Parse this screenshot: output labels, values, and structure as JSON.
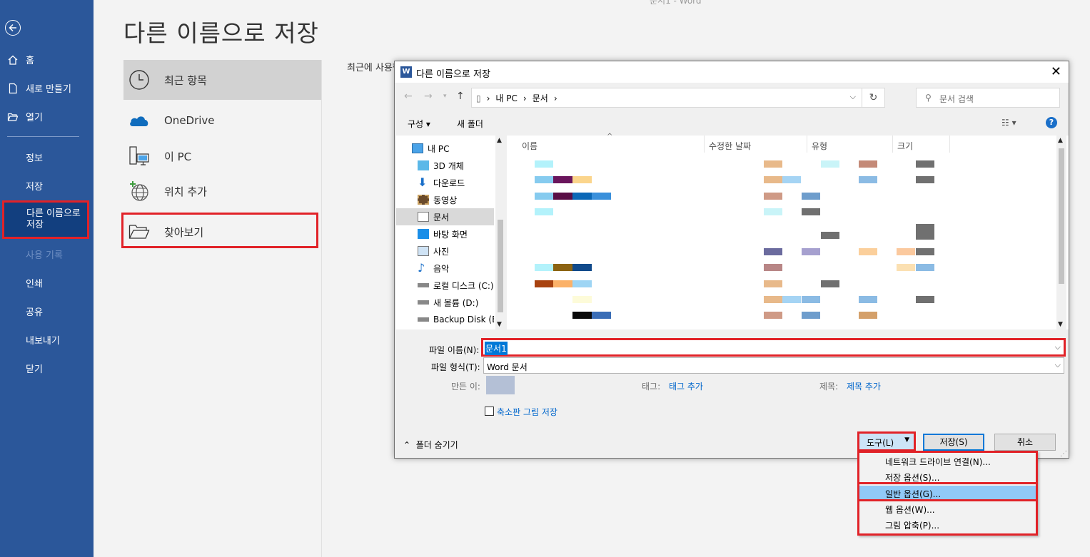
{
  "nav": {
    "items": [
      {
        "label": "홈"
      },
      {
        "label": "새로 만들기"
      },
      {
        "label": "열기"
      },
      {
        "label": "정보"
      },
      {
        "label": "저장"
      },
      {
        "label": "다른 이름으로 저장"
      },
      {
        "label": "사용 기록"
      },
      {
        "label": "인쇄"
      },
      {
        "label": "공유"
      },
      {
        "label": "내보내기"
      },
      {
        "label": "닫기"
      }
    ]
  },
  "page": {
    "title": "다른 이름으로 저장",
    "top_faint": "문서1 - Word",
    "recent_label": "최근에 사용한"
  },
  "places": [
    {
      "label": "최근 항목",
      "icon": "clock-icon"
    },
    {
      "label": "OneDrive",
      "icon": "onedrive-cloud-icon"
    },
    {
      "label": "이 PC",
      "icon": "pc-icon"
    },
    {
      "label": "위치 추가",
      "icon": "add-place-icon"
    },
    {
      "label": "찾아보기",
      "icon": "folder-open-icon"
    }
  ],
  "dialog": {
    "title": "다른 이름으로 저장",
    "breadcrumbs": [
      "내 PC",
      "문서"
    ],
    "search_placeholder": "문서 검색",
    "toolbar": {
      "organize": "구성 ▾",
      "new_folder": "새 폴더"
    },
    "tree": [
      {
        "label": "내 PC"
      },
      {
        "label": "3D 개체"
      },
      {
        "label": "다운로드"
      },
      {
        "label": "동영상"
      },
      {
        "label": "문서",
        "selected": true
      },
      {
        "label": "바탕 화면"
      },
      {
        "label": "사진"
      },
      {
        "label": "음악"
      },
      {
        "label": "로컬 디스크 (C:)"
      },
      {
        "label": "새 볼륨 (D:)"
      },
      {
        "label": "Backup Disk (E:)"
      }
    ],
    "columns": [
      "이름",
      "수정한 날짜",
      "유형",
      "크기"
    ],
    "filename_label": "파일 이름(N):",
    "filename_value": "문서1",
    "filetype_label": "파일 형식(T):",
    "filetype_value": "Word 문서",
    "author_label": "만든 이:",
    "tags_label": "태그:",
    "tags_value": "태그 추가",
    "title_label": "제목:",
    "title_value": "제목 추가",
    "thumbnail_label": "축소판 그림 저장",
    "hide_folders": "폴더 숨기기",
    "tools_label": "도구(L)",
    "save_label": "저장(S)",
    "cancel_label": "취소"
  },
  "tools_menu": [
    {
      "label": "네트워크 드라이브 연결(N)..."
    },
    {
      "label": "저장 옵션(S)..."
    },
    {
      "label": "일반 옵션(G)...",
      "highlighted": true
    },
    {
      "label": "웹 옵션(W)..."
    },
    {
      "label": "그림 압축(P)..."
    }
  ],
  "colors": {
    "nav_bg": "#2b579a",
    "annotation_red": "#e12228",
    "selection_blue": "#0078d7",
    "menu_highlight": "#91c9f7"
  }
}
